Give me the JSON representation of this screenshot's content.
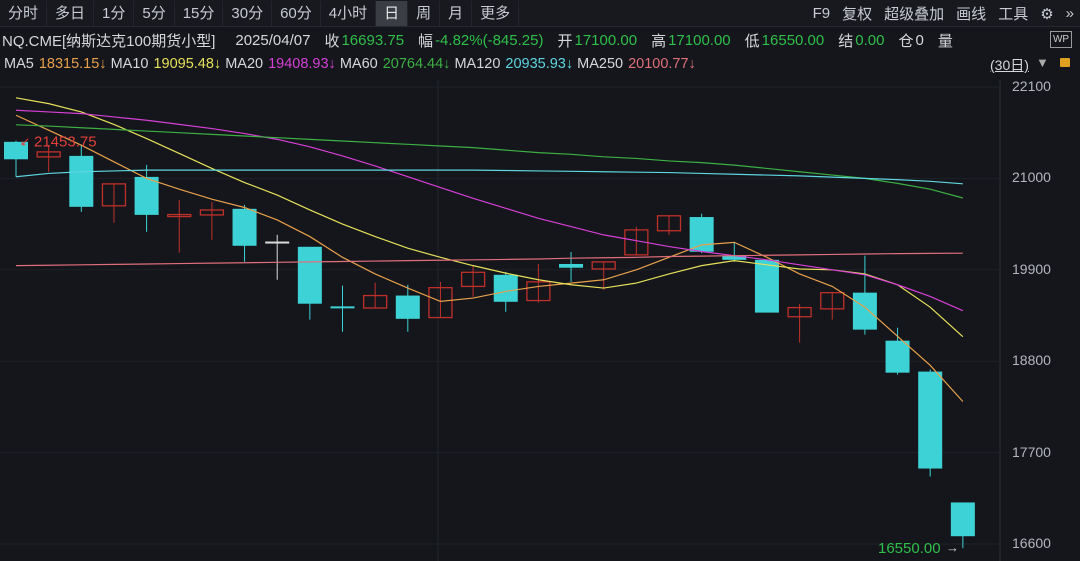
{
  "tabs": [
    "分时",
    "多日",
    "1分",
    "5分",
    "15分",
    "30分",
    "60分",
    "4小时",
    "日",
    "周",
    "月",
    "更多"
  ],
  "active_tab": "日",
  "tools": [
    "F9",
    "复权",
    "超级叠加",
    "画线",
    "工具"
  ],
  "info": {
    "symbol": "NQ.CME[纳斯达克100期货小型]",
    "date": "2025/04/07",
    "close_label": "收",
    "close": "16693.75",
    "change_label": "幅",
    "change": "-4.82%(-845.25)",
    "open_label": "开",
    "open": "17100.00",
    "high_label": "高",
    "high": "17100.00",
    "low_label": "低",
    "low": "16550.00",
    "settle_label": "结",
    "settle": "0.00",
    "oi_label": "仓",
    "oi": "0",
    "vol_label": "量"
  },
  "ma_legend": [
    {
      "name": "MA5",
      "value": "18315.15↓",
      "color": "#e8a04a"
    },
    {
      "name": "MA10",
      "value": "19095.48↓",
      "color": "#e6e05a"
    },
    {
      "name": "MA20",
      "value": "19408.93↓",
      "color": "#d63fd6"
    },
    {
      "name": "MA60",
      "value": "20764.44↓",
      "color": "#3cb043"
    },
    {
      "name": "MA120",
      "value": "20935.93↓",
      "color": "#5fd5e0"
    },
    {
      "name": "MA250",
      "value": "20100.77↓",
      "color": "#e06f7a"
    }
  ],
  "period": "(30日)",
  "chart_data": {
    "type": "candlestick",
    "ylim": [
      16600,
      22100
    ],
    "yticks": [
      "22100",
      "21000",
      "19900",
      "18800",
      "17700",
      "16600"
    ],
    "max_label": "21453.75",
    "min_label": "16550.00",
    "candles": [
      [
        21440,
        21230,
        21453.75,
        21020
      ],
      [
        21259,
        21319,
        21403,
        21078
      ],
      [
        21271,
        20658,
        21403,
        20597
      ],
      [
        20670,
        20934,
        20934,
        20465
      ],
      [
        21018,
        20561,
        21162,
        20357
      ],
      [
        20550,
        20565,
        20742,
        20105
      ],
      [
        20560,
        20620,
        20718,
        20261
      ],
      [
        20634,
        20189,
        20682,
        19997
      ],
      [
        20240,
        20240,
        20321,
        19780
      ],
      [
        20177,
        19492,
        20177,
        19300
      ],
      [
        19460,
        19440,
        19710,
        19155
      ],
      [
        19440,
        19590,
        19745,
        19440
      ],
      [
        19590,
        19310,
        19720,
        19155
      ],
      [
        19325,
        19685,
        19755,
        19325
      ],
      [
        19700,
        19870,
        19950,
        19575
      ],
      [
        19840,
        19515,
        19875,
        19395
      ],
      [
        19530,
        19755,
        19970,
        19505
      ],
      [
        19970,
        19925,
        20115,
        19755
      ],
      [
        19910,
        19995,
        19995,
        19660
      ],
      [
        20080,
        20380,
        20420,
        20080
      ],
      [
        20370,
        20550,
        20550,
        20320
      ],
      [
        20535,
        20117,
        20575,
        20100
      ],
      [
        20070,
        20020,
        20225,
        19995
      ],
      [
        20020,
        19385,
        20020,
        19385
      ],
      [
        19335,
        19445,
        19490,
        19025
      ],
      [
        19430,
        19625,
        19625,
        19300
      ],
      [
        19625,
        19180,
        20070,
        19120
      ],
      [
        19047,
        18662,
        19203,
        18638
      ],
      [
        18675,
        17508,
        18700,
        17412
      ],
      [
        17100,
        16693.75,
        17100,
        16550
      ]
    ],
    "ma_series": {
      "MA5": [
        21760,
        21580,
        21400,
        21200,
        21000,
        20870,
        20750,
        20650,
        20500,
        20300,
        20050,
        19850,
        19680,
        19520,
        19560,
        19640,
        19700,
        19740,
        19780,
        19900,
        20050,
        20200,
        20230,
        20050,
        19850,
        19700,
        19450,
        19100,
        18750,
        18315
      ],
      "MA10": [
        21970,
        21900,
        21800,
        21650,
        21480,
        21300,
        21120,
        20950,
        20800,
        20620,
        20450,
        20300,
        20160,
        20050,
        19950,
        19860,
        19780,
        19720,
        19680,
        19740,
        19850,
        19950,
        20010,
        19960,
        19910,
        19900,
        19850,
        19720,
        19450,
        19095
      ],
      "MA20": [
        21820,
        21800,
        21780,
        21740,
        21700,
        21650,
        21600,
        21540,
        21470,
        21380,
        21270,
        21150,
        21020,
        20890,
        20760,
        20640,
        20520,
        20420,
        20320,
        20250,
        20180,
        20120,
        20070,
        20020,
        19960,
        19900,
        19840,
        19720,
        19580,
        19408
      ],
      "MA60": [
        21645,
        21630,
        21610,
        21590,
        21570,
        21550,
        21530,
        21510,
        21490,
        21470,
        21450,
        21430,
        21410,
        21390,
        21370,
        21340,
        21310,
        21290,
        21260,
        21240,
        21210,
        21190,
        21160,
        21120,
        21080,
        21040,
        21000,
        20940,
        20870,
        20764
      ],
      "MA120": [
        21020,
        21060,
        21080,
        21090,
        21100,
        21100,
        21100,
        21100,
        21100,
        21100,
        21100,
        21100,
        21100,
        21100,
        21100,
        21095,
        21090,
        21085,
        21080,
        21075,
        21070,
        21060,
        21050,
        21040,
        21030,
        21015,
        21000,
        20985,
        20965,
        20935
      ],
      "MA250": [
        19950,
        19955,
        19960,
        19965,
        19970,
        19975,
        19980,
        19985,
        19990,
        19995,
        20000,
        20005,
        20010,
        20015,
        20020,
        20025,
        20030,
        20040,
        20045,
        20050,
        20060,
        20065,
        20070,
        20075,
        20080,
        20085,
        20090,
        20095,
        20098,
        20100
      ]
    }
  }
}
